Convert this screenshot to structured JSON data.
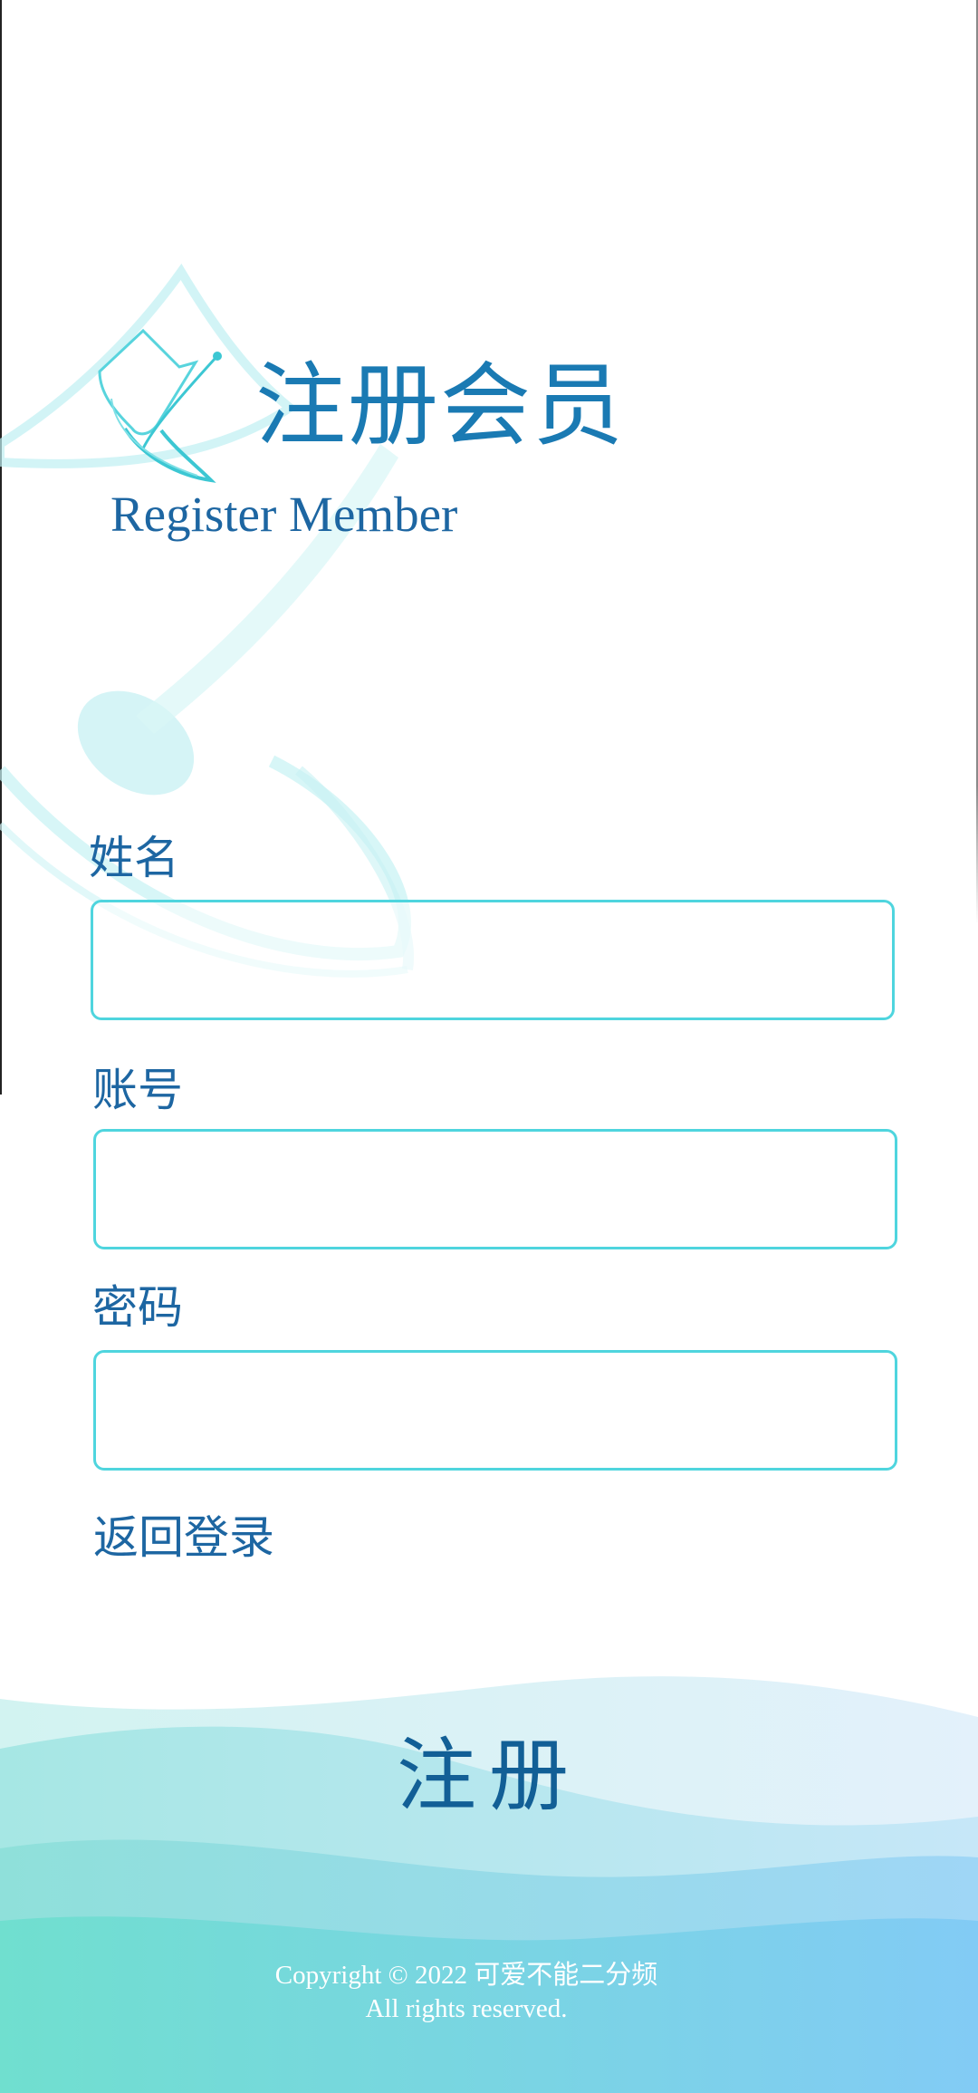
{
  "header": {
    "title_cn": "注册会员",
    "title_en": "Register Member",
    "logo_icon": "satellite-dish-icon"
  },
  "form": {
    "name_label": "姓名",
    "name_value": "",
    "account_label": "账号",
    "account_value": "",
    "password_label": "密码",
    "password_value": ""
  },
  "links": {
    "back_to_login": "返回登录"
  },
  "actions": {
    "register_label": "注册"
  },
  "footer": {
    "copyright_line1": "Copyright © 2022 可爱不能二分频",
    "copyright_line2": "All rights reserved."
  },
  "colors": {
    "accent": "#4fd5de",
    "text": "#1d66a2",
    "wave_light": "#bfeef0",
    "wave_dark": "#7fcff5"
  }
}
